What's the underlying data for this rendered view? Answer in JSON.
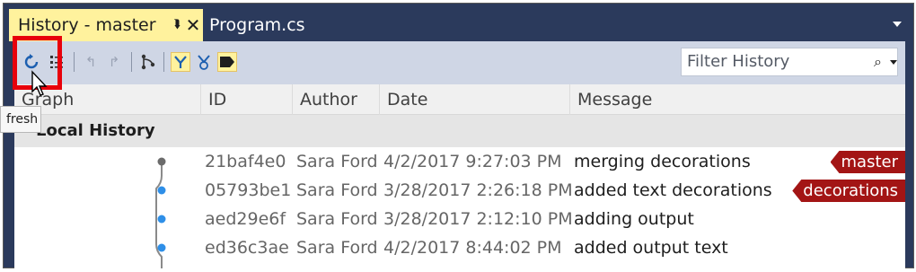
{
  "tabs": {
    "active": {
      "label": "History - master",
      "pin_icon": "pin-icon",
      "close_icon": "close-icon"
    },
    "other": {
      "label": "Program.cs"
    }
  },
  "toolbar": {
    "icons": [
      "refresh-icon",
      "settings-list-icon",
      "navigate-back-icon",
      "navigate-forward-icon",
      "branch-graph-icon",
      "merge-toggle-icon",
      "remote-toggle-icon",
      "tag-toggle-icon"
    ],
    "filter_placeholder": "Filter History",
    "filter_icon": "search-icon"
  },
  "columns": [
    {
      "label": "Graph"
    },
    {
      "label": "ID"
    },
    {
      "label": "Author"
    },
    {
      "label": "Date"
    },
    {
      "label": "Message"
    }
  ],
  "group": {
    "label": "Local History"
  },
  "commits": [
    {
      "id": "21baf4e0",
      "author": "Sara Ford",
      "date": "4/2/2017 9:27:03 PM",
      "message": "merging decorations",
      "badge": "master"
    },
    {
      "id": "05793be1",
      "author": "Sara Ford",
      "date": "3/28/2017 2:26:18 PM",
      "message": "added text decorations",
      "badge": "decorations"
    },
    {
      "id": "aed29e6f",
      "author": "Sara Ford",
      "date": "3/28/2017 2:12:10 PM",
      "message": "adding output",
      "badge": ""
    },
    {
      "id": "ed36c3ae",
      "author": "Sara Ford",
      "date": "4/2/2017 8:44:02 PM",
      "message": "added output text",
      "badge": ""
    }
  ],
  "tooltip": {
    "text": "fresh"
  },
  "colors": {
    "accent_tab": "#fff29d",
    "branch_badge": "#a31515",
    "graph_node_blue": "#2e8fe8",
    "highlight_box": "#e8000b",
    "chrome": "#2b3a5c"
  }
}
